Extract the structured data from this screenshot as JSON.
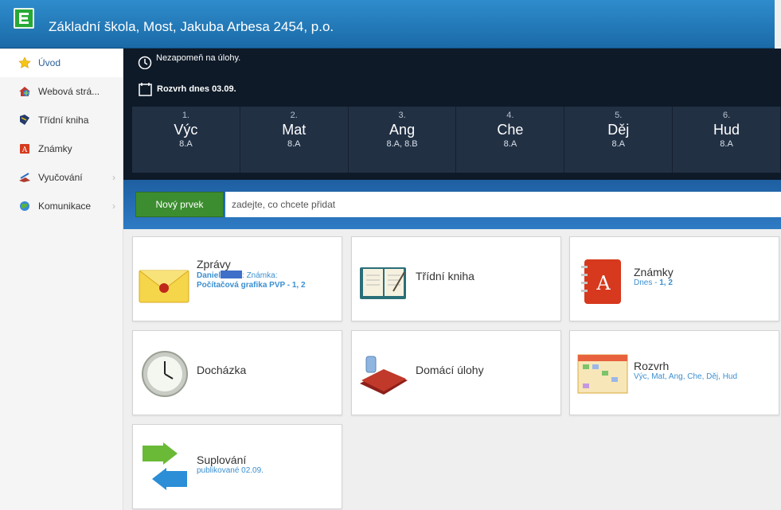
{
  "header": {
    "title": "Základní škola, Most, Jakuba Arbesa 2454, p.o."
  },
  "sidebar": {
    "items": [
      {
        "label": "Úvod",
        "icon": "star-icon"
      },
      {
        "label": "Webová strá...",
        "icon": "web-icon"
      },
      {
        "label": "Třídní kniha",
        "icon": "book-icon"
      },
      {
        "label": "Známky",
        "icon": "grades-icon"
      },
      {
        "label": "Vyučování",
        "icon": "teaching-icon",
        "chevron": "›"
      },
      {
        "label": "Komunikace",
        "icon": "communication-icon",
        "chevron": "›"
      }
    ]
  },
  "reminder": {
    "text": "Nezapomeň na úlohy."
  },
  "schedule": {
    "heading": "Rozvrh dnes 03.09.",
    "lessons": [
      {
        "num": "1.",
        "subject": "Výc",
        "class": "8.A"
      },
      {
        "num": "2.",
        "subject": "Mat",
        "class": "8.A"
      },
      {
        "num": "3.",
        "subject": "Ang",
        "class": "8.A, 8.B"
      },
      {
        "num": "4.",
        "subject": "Che",
        "class": "8.A"
      },
      {
        "num": "5.",
        "subject": "Děj",
        "class": "8.A"
      },
      {
        "num": "6.",
        "subject": "Hud",
        "class": "8.A"
      }
    ]
  },
  "new_item": {
    "button": "Nový prvek",
    "placeholder": "zadejte, co chcete přidat"
  },
  "tiles": {
    "zpravy": {
      "title": "Zprávy",
      "sub_name": "Daniel",
      "sub_rest": ": Známka:",
      "sub_detail": "Počítačová grafika PVP - 1, 2"
    },
    "tridni_kniha": {
      "title": "Třídní kniha"
    },
    "znamky": {
      "title": "Známky",
      "sub_prefix": "Dnes - ",
      "sub_value": "1, 2"
    },
    "dochazka": {
      "title": "Docházka"
    },
    "domaci_ulohy": {
      "title": "Domácí úlohy"
    },
    "rozvrh": {
      "title": "Rozvrh",
      "sub": "Výc, Mat, Ang, Che, Děj, Hud"
    },
    "suplovani": {
      "title": "Suplování",
      "sub": "publikované 02.09."
    }
  },
  "colors": {
    "header_blue": "#1f74b6",
    "dark_bg": "#0e1a28",
    "accent_green": "#3c8d2f",
    "link_blue": "#3b8fd1"
  }
}
